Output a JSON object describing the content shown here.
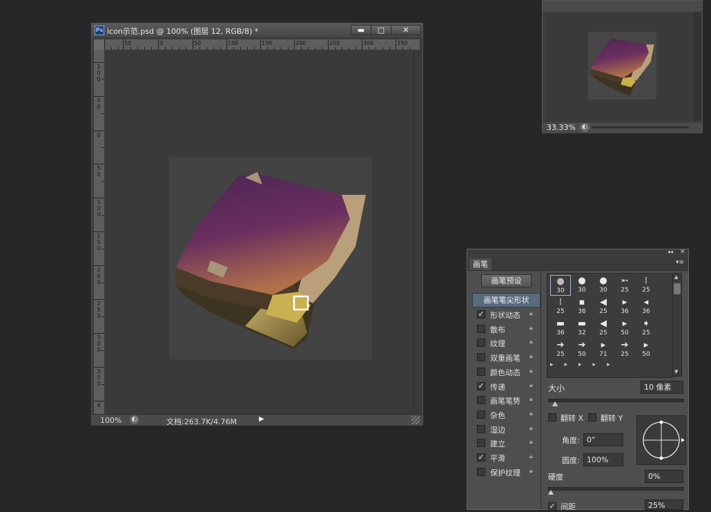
{
  "document": {
    "title": "icon示范.psd @ 100% (图层 12, RGB/8) *",
    "ps_badge": "Ps",
    "buttons": {
      "minimize": "▬",
      "restore": "□",
      "close": "✕"
    },
    "hruler_labels": [
      "50",
      "0",
      "50",
      "100",
      "150",
      "200",
      "250",
      "300",
      "350"
    ],
    "vruler_labels": [
      "100",
      "50",
      "0",
      "50",
      "100",
      "150",
      "200",
      "250",
      "300",
      "350",
      "4"
    ],
    "status_zoom": "100%",
    "status_doc": "文档:263.7K/4.76M",
    "status_arrow": "▶"
  },
  "navigator": {
    "zoom": "33.33%"
  },
  "brush_panel": {
    "tab": "画笔",
    "collapse_icon": "◂◂",
    "close_icon": "✕",
    "menu_icon": "▾≡",
    "preset_button": "画笔预设",
    "tip_shape_label": "画笔笔尖形状",
    "options": [
      {
        "label": "形状动态",
        "checked": true
      },
      {
        "label": "散布",
        "checked": false
      },
      {
        "label": "纹理",
        "checked": false
      },
      {
        "label": "双重画笔",
        "checked": false
      },
      {
        "label": "颜色动态",
        "checked": false
      },
      {
        "label": "传递",
        "checked": true
      },
      {
        "label": "画笔笔势",
        "checked": false
      },
      {
        "label": "杂色",
        "checked": false
      },
      {
        "label": "湿边",
        "checked": false
      },
      {
        "label": "建立",
        "checked": false
      },
      {
        "label": "平滑",
        "checked": true
      },
      {
        "label": "保护纹理",
        "checked": false
      }
    ],
    "tips": [
      {
        "glyph": "●",
        "size": "30"
      },
      {
        "glyph": "●",
        "size": "30"
      },
      {
        "glyph": "●",
        "size": "30"
      },
      {
        "glyph": "➵",
        "size": "25"
      },
      {
        "glyph": "⁞",
        "size": "25"
      },
      {
        "glyph": "⁞",
        "size": "25"
      },
      {
        "glyph": "▪",
        "size": "36"
      },
      {
        "glyph": "◀",
        "size": "25"
      },
      {
        "glyph": "▸",
        "size": "36"
      },
      {
        "glyph": "◂",
        "size": "36"
      },
      {
        "glyph": "▬",
        "size": "36"
      },
      {
        "glyph": "▬",
        "size": "32"
      },
      {
        "glyph": "◀",
        "size": "25"
      },
      {
        "glyph": "▸",
        "size": "50"
      },
      {
        "glyph": "➧",
        "size": "25"
      },
      {
        "glyph": "➔",
        "size": "25"
      },
      {
        "glyph": "➔",
        "size": "50"
      },
      {
        "glyph": "▸",
        "size": "71"
      },
      {
        "glyph": "➔",
        "size": "25"
      },
      {
        "glyph": "▸",
        "size": "50"
      }
    ],
    "size_label": "大小",
    "size_value": "10 像素",
    "size_fraction": 0.03,
    "flip_x_label": "翻转 X",
    "flip_y_label": "翻转 Y",
    "angle_label": "角度:",
    "angle_value": "0°",
    "roundness_label": "圆度:",
    "roundness_value": "100%",
    "hardness_label": "硬度",
    "hardness_value": "0%",
    "hardness_fraction": 0.0,
    "spacing_label": "间距",
    "spacing_value": "25%",
    "spacing_checked": true
  }
}
